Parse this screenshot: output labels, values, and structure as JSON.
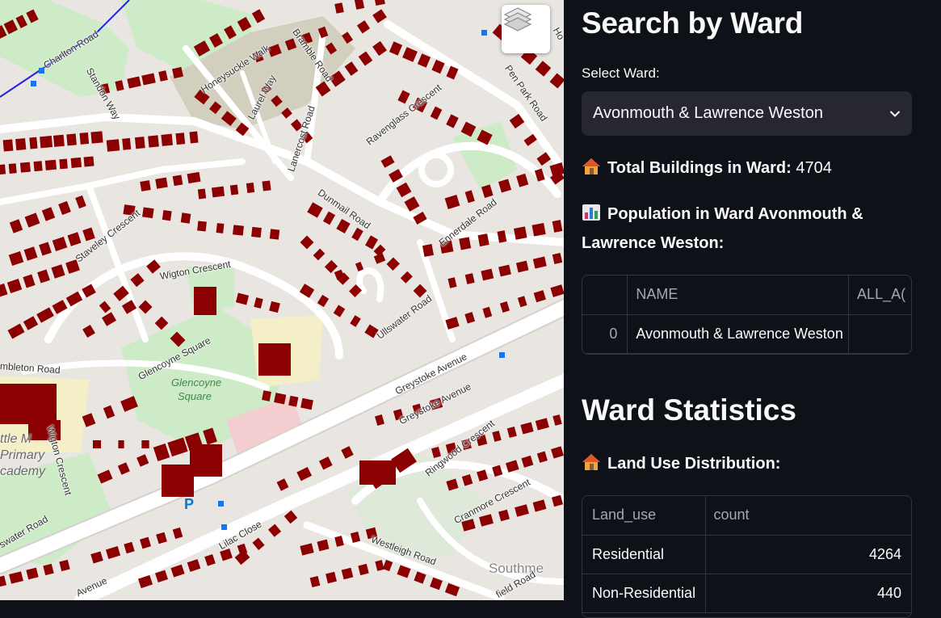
{
  "map": {
    "labels": {
      "charlton_road": "Charlton Road",
      "standon_way": "Standon Way",
      "honeysuckle_walk": "Honeysuckle Walk",
      "bramble_road": "Bramble Road",
      "laurel_way": "Laurel Way",
      "lanercost_road": "Lanercost Road",
      "pen_park_road": "Pen Park Road",
      "ravenglass_crescent": "Ravenglass Crescent",
      "dunmail_road": "Dunmail Road",
      "ennerdale_road": "Ennerdale Road",
      "staveley_crescent": "Staveley Crescent",
      "wigton_crescent": "Wigton Crescent",
      "ullswater_road": "Ullswater Road",
      "glencoyne_square": "Glencoyne Square",
      "glencoyne_park_1": "Glencoyne",
      "glencoyne_park_2": "Square",
      "greystoke_avenue_1": "Greystoke Avenue",
      "greystoke_avenue_2": "Greystoke Avenue",
      "embleton_road": "mbleton Road",
      "wigton_crescent_2": "Wigton Crescent",
      "school_1": "ttle M",
      "school_2": "Primary",
      "school_3": "cademy",
      "ringwood_crescent": "Ringwood Crescent",
      "cranmore_crescent": "Cranmore Crescent",
      "westleigh_road": "Westleigh Road",
      "lilac_close": "Lilac Close",
      "swater_road": "swater Road",
      "avenue": "Avenue",
      "southmead": "Southme",
      "field_road": "field Road",
      "ho": "Ho",
      "parking": "P"
    },
    "layers_icon": "layers-icon"
  },
  "panel": {
    "title": "Search by Ward",
    "select_label": "Select Ward:",
    "select_value": "Avonmouth & Lawrence Weston",
    "total_label": "Total Buildings in Ward:",
    "total_value": "4704",
    "population_label": "Population in Ward Avonmouth &",
    "population_label_2": "Lawrence Weston:",
    "population_table": {
      "columns": [
        "",
        "NAME",
        "ALL_A("
      ],
      "rows": [
        [
          "0",
          "Avonmouth & Lawrence Weston",
          ""
        ]
      ]
    },
    "stats_title": "Ward Statistics",
    "landuse_label": "Land Use Distribution:",
    "landuse_table": {
      "columns": [
        "Land_use",
        "count"
      ],
      "rows": [
        [
          "Residential",
          "4264"
        ],
        [
          "Non-Residential",
          "440"
        ]
      ]
    },
    "icons": {
      "house": "house-icon",
      "chart": "bar-chart-icon",
      "chevron": "chevron-down-icon"
    },
    "colors": {
      "background": "#0e1117",
      "select_bg": "#262730",
      "border": "#31333f",
      "building": "#8b0000"
    }
  }
}
